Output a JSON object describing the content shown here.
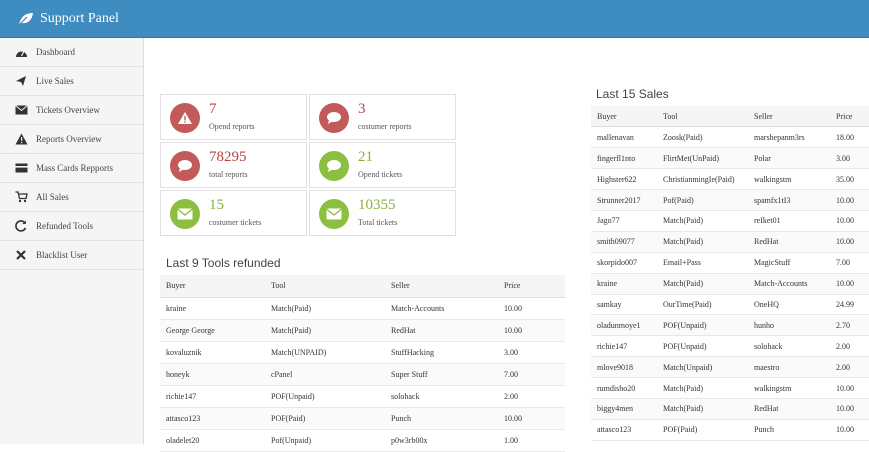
{
  "app": {
    "title": "Support Panel"
  },
  "sidebar": {
    "items": [
      {
        "label": "Dashboard",
        "icon": "dashboard-icon"
      },
      {
        "label": "Live Sales",
        "icon": "paper-plane-icon"
      },
      {
        "label": "Tickets Overview",
        "icon": "envelope-icon"
      },
      {
        "label": "Reports Overview",
        "icon": "warning-icon"
      },
      {
        "label": "Mass Cards Repports",
        "icon": "credit-card-icon"
      },
      {
        "label": "All Sales",
        "icon": "cart-icon"
      },
      {
        "label": "Refunded Tools",
        "icon": "refresh-icon"
      },
      {
        "label": "Blacklist User",
        "icon": "x-icon"
      }
    ]
  },
  "stats": [
    {
      "value": "7",
      "label": "Opend reports",
      "color": "#c35a5a",
      "icon": "warning-icon"
    },
    {
      "value": "3",
      "label": "costumer reports",
      "color": "#c35a5a",
      "icon": "chat-icon"
    },
    {
      "value": "78295",
      "label": "total reports",
      "color": "#c35a5a",
      "icon": "chat-icon"
    },
    {
      "value": "21",
      "label": "Opend tickets",
      "color": "#8cbf3f",
      "icon": "chat-icon"
    },
    {
      "value": "15",
      "label": "costumer tickets",
      "color": "#8cbf3f",
      "icon": "envelope-icon"
    },
    {
      "value": "10355",
      "label": "Total tickets",
      "color": "#8cbf3f",
      "icon": "envelope-icon"
    }
  ],
  "refunded": {
    "title": "Last 9 Tools refunded",
    "headers": [
      "Buyer",
      "Tool",
      "Seller",
      "Price"
    ],
    "rows": [
      [
        "kraine",
        "Match(Paid)",
        "Match-Accounts",
        "10.00"
      ],
      [
        "George George",
        "Match(Paid)",
        "RedHat",
        "10.00"
      ],
      [
        "kovaluznik",
        "Match(UNPAID)",
        "StuffHacking",
        "3.00"
      ],
      [
        "honeyk",
        "cPanel",
        "Super Stuff",
        "7.00"
      ],
      [
        "richie147",
        "POF(Unpaid)",
        "solohack",
        "2.00"
      ],
      [
        "attasco123",
        "POF(Paid)",
        "Punch",
        "10.00"
      ],
      [
        "oladelet20",
        "Pof(Unpaid)",
        "p0w3rb00x",
        "1.00"
      ]
    ]
  },
  "sales": {
    "title": "Last 15 Sales",
    "headers": [
      "Buyer",
      "Tool",
      "Seller",
      "Price"
    ],
    "rows": [
      [
        "mallenavan",
        "Zoosk(Paid)",
        "marshepanm3rs",
        "18.00"
      ],
      [
        "fingerfl1nto",
        "FlirtMet(UnPaid)",
        "Polar",
        "3.00"
      ],
      [
        "Highster622",
        "ChristianmingIe(Paid)",
        "walkingstm",
        "35.00"
      ],
      [
        "Strunner2017",
        "Pof(Paid)",
        "spamfx1tI3",
        "10.00"
      ],
      [
        "Jago77",
        "Match(Paid)",
        "reIket01",
        "10.00"
      ],
      [
        "smith09077",
        "Match(Paid)",
        "RedHat",
        "10.00"
      ],
      [
        "skorpido007",
        "Email+Pass",
        "MagicStuff",
        "7.00"
      ],
      [
        "kraine",
        "Match(Paid)",
        "Match-Accounts",
        "10.00"
      ],
      [
        "samkay",
        "OurTime(Paid)",
        "OneHQ",
        "24.99"
      ],
      [
        "oladunmoye1",
        "POF(Unpaid)",
        "hunho",
        "2.70"
      ],
      [
        "richie147",
        "POF(Unpaid)",
        "solohack",
        "2.00"
      ],
      [
        "mlove9018",
        "Match(Unpaid)",
        "maestro",
        "2.00"
      ],
      [
        "rumdisho20",
        "Match(Paid)",
        "walkingstm",
        "10.00"
      ],
      [
        "biggy4men",
        "Match(Paid)",
        "RedHat",
        "10.00"
      ],
      [
        "attasco123",
        "POF(Paid)",
        "Punch",
        "10.00"
      ]
    ]
  }
}
